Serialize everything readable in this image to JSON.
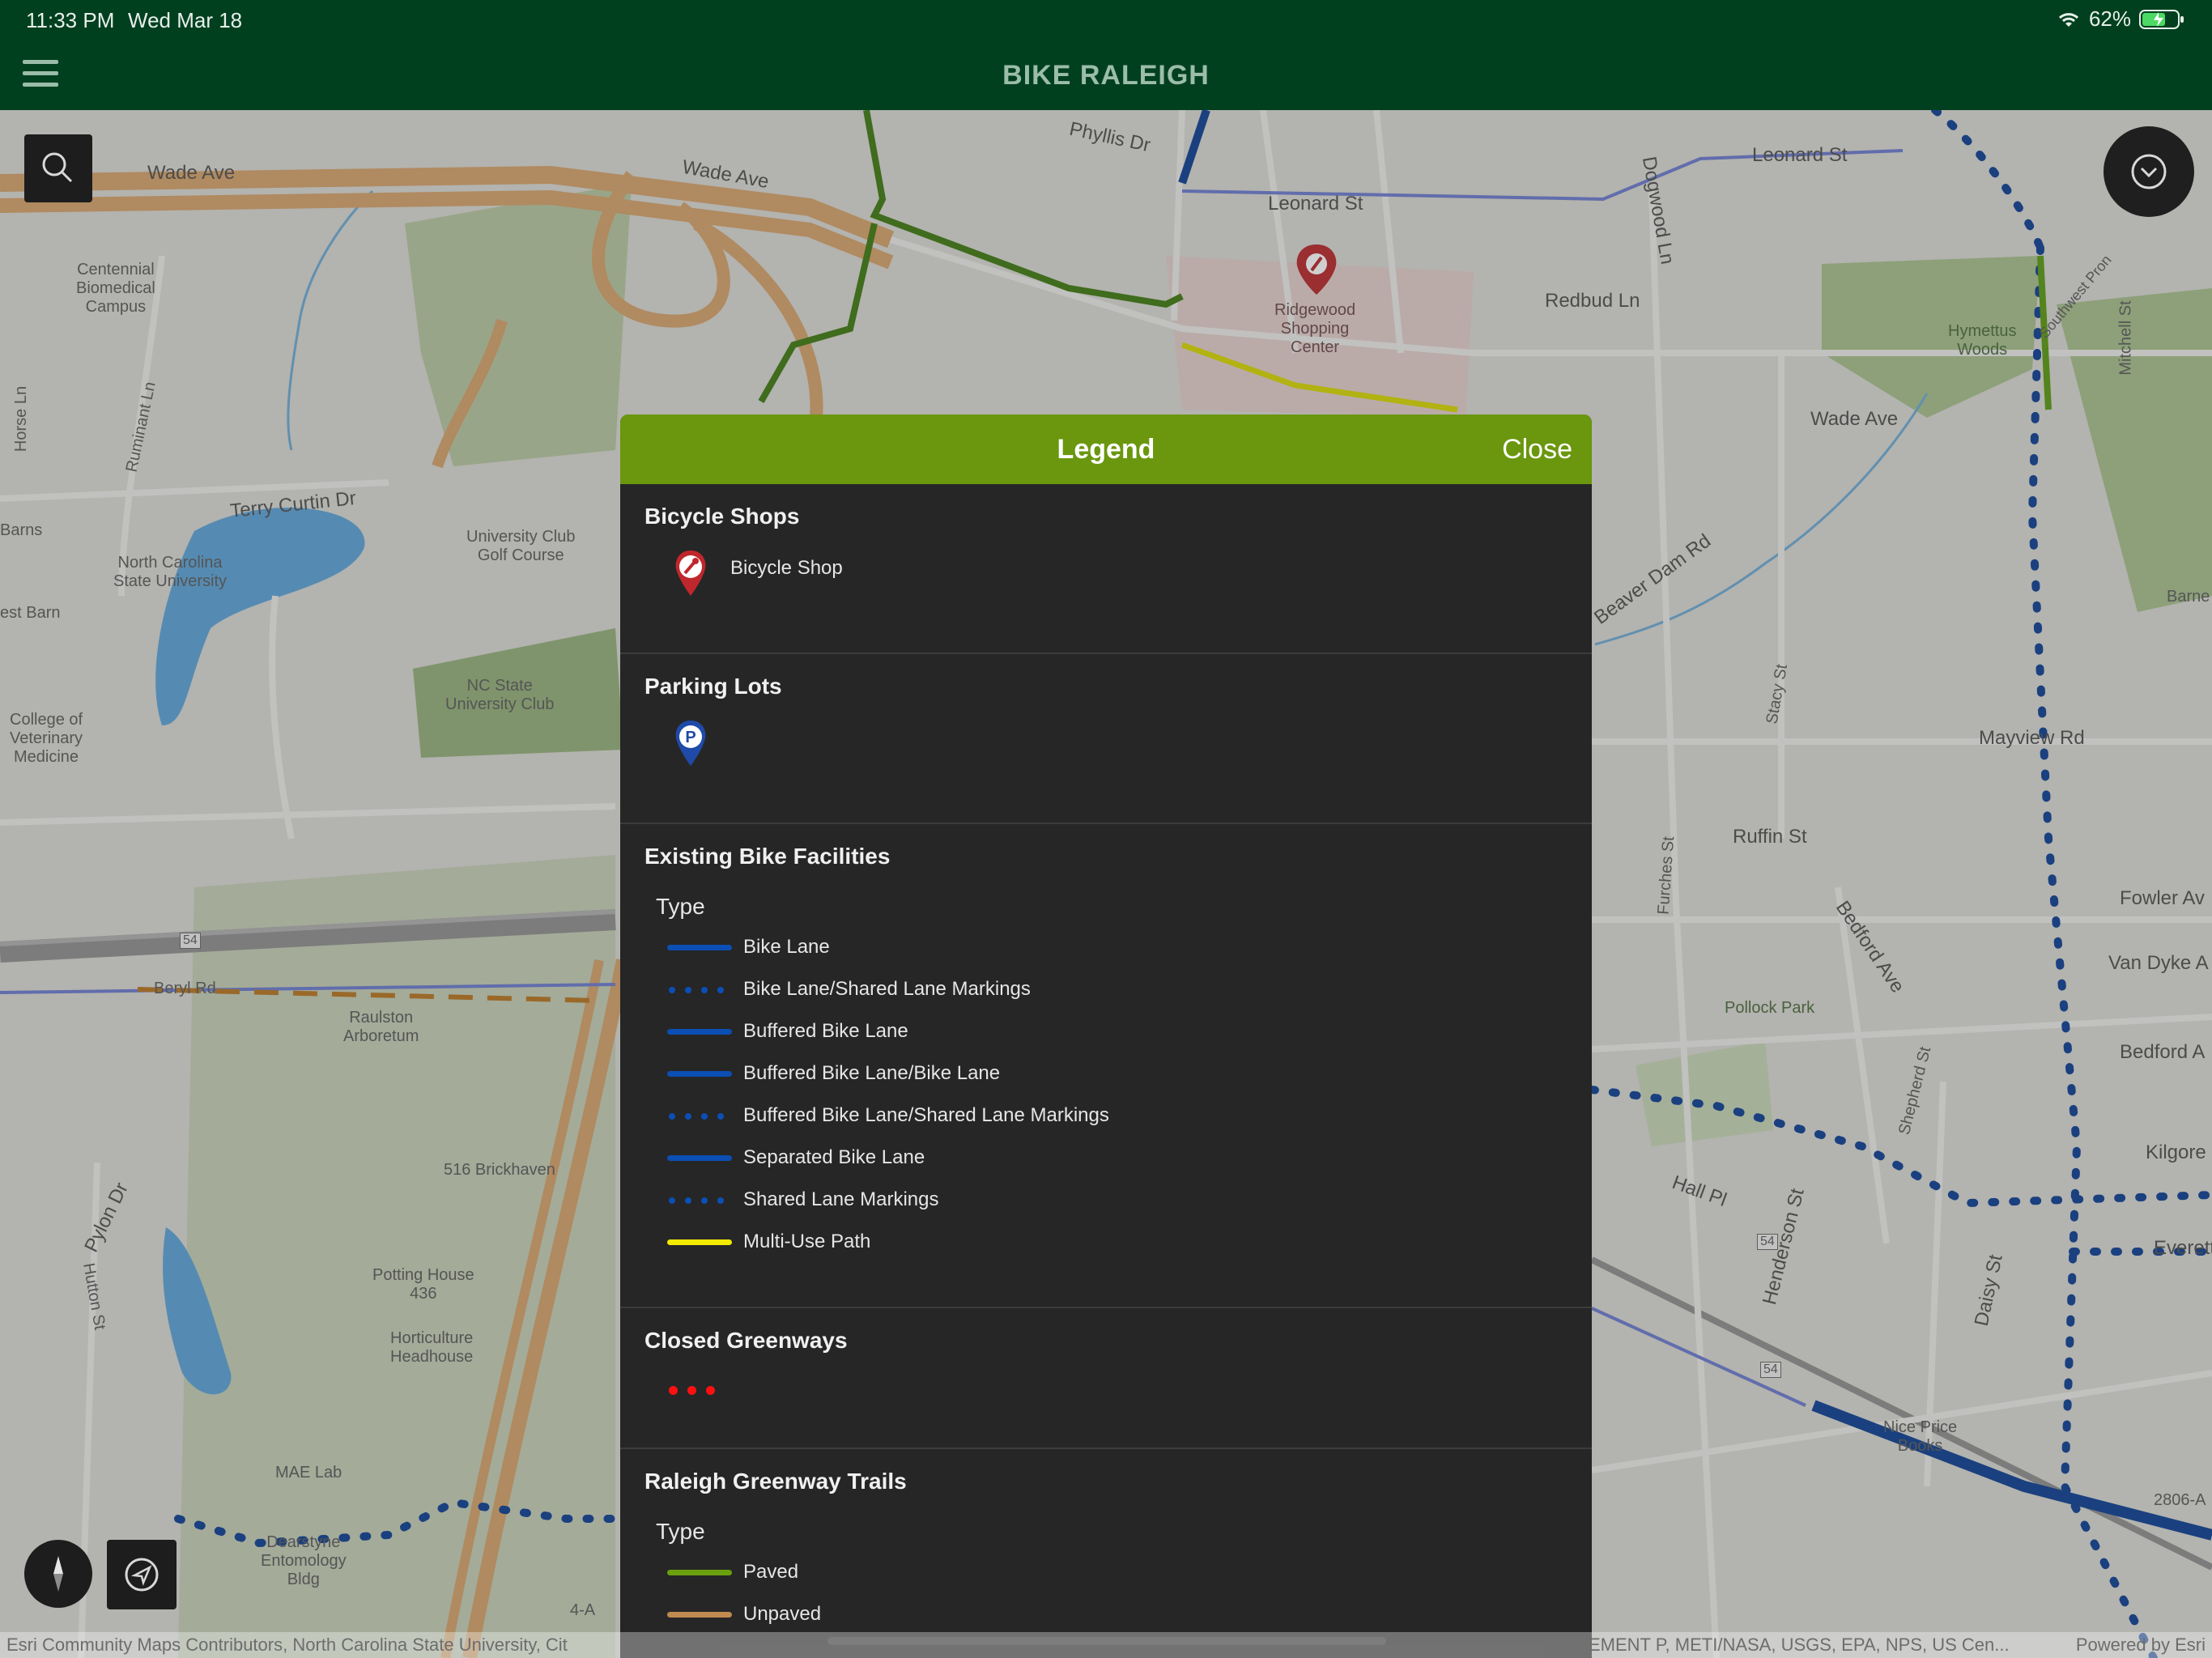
{
  "status_bar": {
    "time": "11:33 PM",
    "date": "Wed Mar 18",
    "battery": "62%"
  },
  "app": {
    "title": "BIKE RALEIGH"
  },
  "map": {
    "labels": {
      "wade_ave_1": "Wade Ave",
      "wade_ave_2": "Wade Ave",
      "wade_ave_3": "Wade Ave",
      "leonard_st_1": "Leonard St",
      "leonard_st_2": "Leonard St",
      "phyllis_dr": "Phyllis Dr",
      "dogwood_ln": "Dogwood Ln",
      "redbud_ln": "Redbud Ln",
      "hymettus_woods": "Hymettus\nWoods",
      "mitchell_st": "Mitchell St",
      "centennial": "Centennial\nBiomedical\nCampus",
      "horse_ln": "Horse Ln",
      "ruminant_ln": "Ruminant Ln",
      "terry_curtin": "Terry Curtin Dr",
      "university_club_golf": "University Club\nGolf Course",
      "barns": "Barns",
      "ncsu": "North Carolina\nState University",
      "west_barn": "est Barn",
      "ncsu_club": "NC State\nUniversity Club",
      "vet_med": "College of\nVeterinary\nMedicine",
      "ridgewood": "Ridgewood\nShopping\nCenter",
      "beaver_dam": "Beaver Dam Rd",
      "stacy_st": "Stacy St",
      "mayview_rd": "Mayview Rd",
      "ruffin_st": "Ruffin St",
      "furches_st": "Furches St",
      "fowler_av": "Fowler Av",
      "van_dyke": "Van Dyke A",
      "bedford_ave": "Bedford Ave",
      "bedford_a": "Bedford A",
      "pollock_park": "Pollock Park",
      "shepherd_st": "Shepherd St",
      "hall_pl": "Hall Pl",
      "henderson_st": "Henderson St",
      "daisy_st": "Daisy St",
      "kilgore": "Kilgore",
      "everett": "Everett",
      "nice_price": "Nice Price\nBooks",
      "addr_2806": "2806-A",
      "beryl_rd": "Beryl Rd",
      "raulston": "Raulston\nArboretum",
      "brickhaven": "516 Brickhaven",
      "pylon_dr": "Pylon Dr",
      "hutton_st": "Hutton St",
      "potting_house": "Potting House\n436",
      "horticulture": "Horticulture\nHeadhouse",
      "mae_lab": "MAE Lab",
      "dearstyne": "Dearstyne\nEntomology\nBldg",
      "four_a": "4-A",
      "route_54_a": "54",
      "route_54_b": "54",
      "route_54_c": "54",
      "barn_right": "Barne",
      "southwest_prong": "Southwest Pron"
    },
    "attribution_left": "Esri Community Maps Contributors, North Carolina State University, Cit",
    "attribution_mid": "EMENT P, METI/NASA, USGS, EPA, NPS, US Cen...",
    "attribution_right": "Powered by Esri"
  },
  "legend": {
    "title": "Legend",
    "close_label": "Close",
    "sections": {
      "bicycle_shops": {
        "title": "Bicycle Shops",
        "item": "Bicycle Shop"
      },
      "parking_lots": {
        "title": "Parking Lots"
      },
      "existing": {
        "title": "Existing Bike Facilities",
        "type_label": "Type",
        "items": [
          {
            "label": "Bike Lane",
            "style": "solid",
            "color": "#0b4fb5"
          },
          {
            "label": "Bike Lane/Shared Lane Markings",
            "style": "dotted",
            "color": "#0b4fb5"
          },
          {
            "label": "Buffered Bike Lane",
            "style": "solid",
            "color": "#0b4fb5"
          },
          {
            "label": "Buffered Bike Lane/Bike Lane",
            "style": "solid",
            "color": "#0b4fb5"
          },
          {
            "label": "Buffered Bike Lane/Shared Lane Markings",
            "style": "dotted",
            "color": "#0b4fb5"
          },
          {
            "label": "Separated Bike Lane",
            "style": "solid",
            "color": "#0b4fb5"
          },
          {
            "label": "Shared Lane Markings",
            "style": "dotted",
            "color": "#0b4fb5"
          },
          {
            "label": "Multi-Use Path",
            "style": "solid",
            "color": "#f2ea00"
          }
        ]
      },
      "closed_greenways": {
        "title": "Closed Greenways",
        "color": "#ff1010"
      },
      "greenway_trails": {
        "title": "Raleigh Greenway Trails",
        "type_label": "Type",
        "items": [
          {
            "label": "Paved",
            "color": "#6aa00e"
          },
          {
            "label": "Unpaved",
            "color": "#c08a50"
          }
        ]
      }
    }
  },
  "colors": {
    "header_bg": "#00401f",
    "legend_header": "#6a970e",
    "bike_shop_pin": "#c0272d",
    "parking_pin": "#1f4aa8"
  },
  "icons": [
    "menu-icon",
    "search-icon",
    "layers-chevron-icon",
    "compass-icon",
    "location-arrow-icon",
    "wifi-icon",
    "battery-icon"
  ]
}
